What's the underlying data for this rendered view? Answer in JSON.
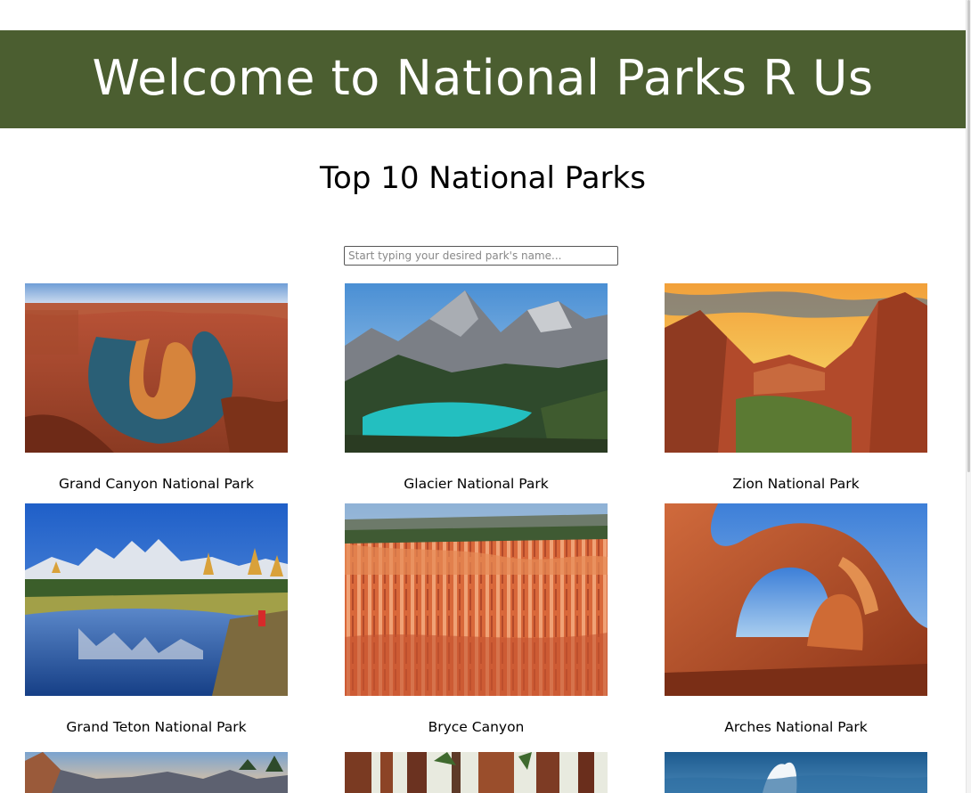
{
  "header": {
    "title": "Welcome to National Parks R Us",
    "background_color": "#4b5e30"
  },
  "main": {
    "heading": "Top 10 National Parks",
    "search": {
      "placeholder": "Start typing your desired park's name...",
      "value": ""
    },
    "parks": [
      {
        "name": "Grand Canyon National Park",
        "image": "grand-canyon-horseshoe-bend-photo"
      },
      {
        "name": "Glacier National Park",
        "image": "glacier-lake-mountain-photo"
      },
      {
        "name": "Zion National Park",
        "image": "zion-canyon-sunset-photo"
      },
      {
        "name": "Grand Teton National Park",
        "image": "grand-teton-reflection-photo"
      },
      {
        "name": "Bryce Canyon",
        "image": "bryce-canyon-hoodoos-photo"
      },
      {
        "name": "Arches National Park",
        "image": "arches-double-arch-photo"
      },
      {
        "name": "",
        "image": "mountain-range-photo"
      },
      {
        "name": "",
        "image": "redwood-forest-photo"
      },
      {
        "name": "",
        "image": "ocean-wave-photo"
      }
    ]
  }
}
